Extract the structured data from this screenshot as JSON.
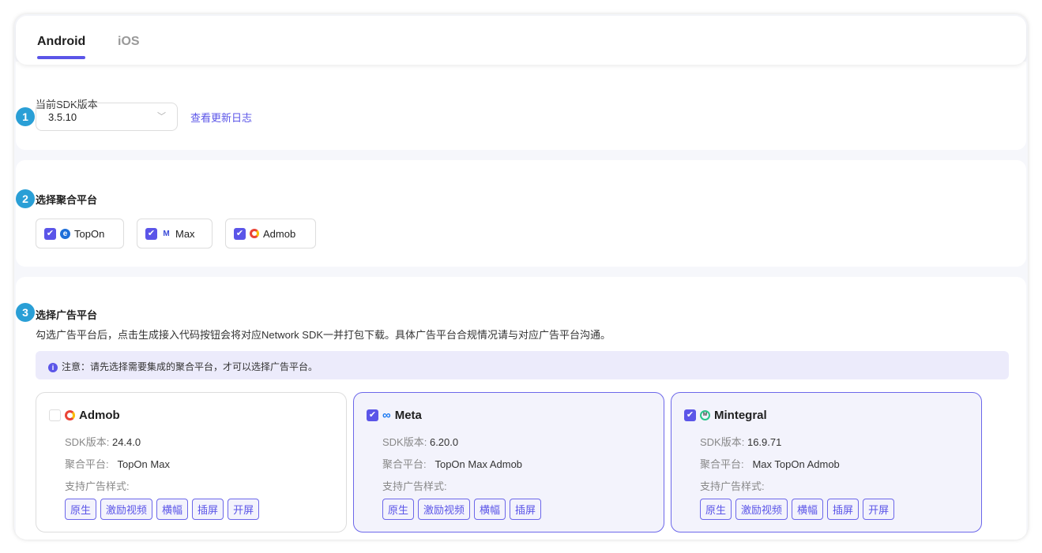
{
  "tabs": [
    {
      "label": "Android",
      "active": true
    },
    {
      "label": "iOS",
      "active": false
    }
  ],
  "sdk": {
    "label": "当前SDK版本",
    "version": "3.5.10",
    "changelog": "查看更新日志",
    "step": "1"
  },
  "aggregation": {
    "step": "2",
    "title": "选择聚合平台",
    "items": [
      {
        "label": "TopOn",
        "checked": true
      },
      {
        "label": "Max",
        "checked": true
      },
      {
        "label": "Admob",
        "checked": true
      }
    ]
  },
  "ad_platforms": {
    "step": "3",
    "title": "选择广告平台",
    "description": "勾选广告平台后，点击生成接入代码按钮会将对应Network SDK一并打包下载。具体广告平台合规情况请与对应广告平台沟通。",
    "notice": "注意：请先选择需要集成的聚合平台，才可以选择广告平台。",
    "sdk_label": "SDK版本:",
    "agg_label": "聚合平台:",
    "styles_label": "支持广告样式:",
    "cards": [
      {
        "name": "Admob",
        "checked": false,
        "sdk": "24.4.0",
        "agg": "TopOn Max",
        "styles": [
          "原生",
          "激励视频",
          "横幅",
          "插屏",
          "开屏"
        ]
      },
      {
        "name": "Meta",
        "checked": true,
        "sdk": "6.20.0",
        "agg": "TopOn Max Admob",
        "styles": [
          "原生",
          "激励视频",
          "横幅",
          "插屏"
        ]
      },
      {
        "name": "Mintegral",
        "checked": true,
        "sdk": "16.9.71",
        "agg": "Max TopOn Admob",
        "styles": [
          "原生",
          "激励视频",
          "横幅",
          "插屏",
          "开屏"
        ]
      }
    ]
  },
  "colors": {
    "accent": "#5b55e8",
    "badge": "#2a9fd6",
    "notice_bg": "#ecebfb"
  }
}
